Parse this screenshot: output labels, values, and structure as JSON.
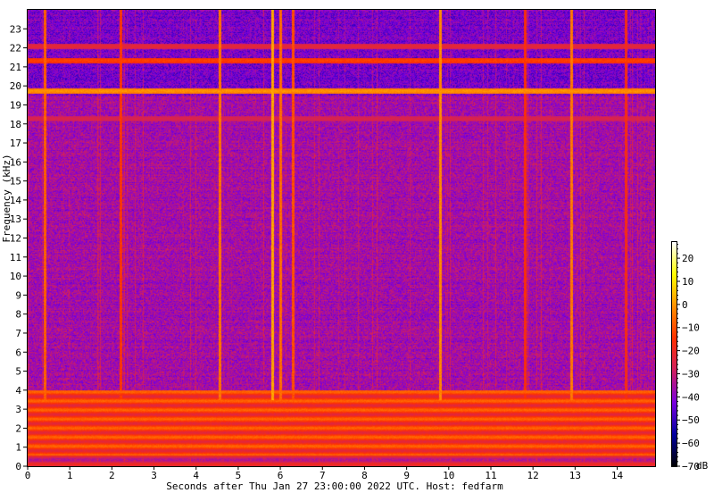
{
  "chart_data": {
    "type": "heatmap",
    "title": "",
    "xlabel": "Seconds after Thu Jan 27 23:00:00 2022 UTC. Host: fedfarm",
    "ylabel": "Frequency (kHz)",
    "xlim": [
      0,
      14.9
    ],
    "ylim": [
      0,
      24
    ],
    "xticks": [
      0,
      1,
      2,
      3,
      4,
      5,
      6,
      7,
      8,
      9,
      10,
      11,
      12,
      13,
      14
    ],
    "yticks": [
      0,
      1,
      2,
      3,
      4,
      5,
      6,
      7,
      8,
      9,
      10,
      11,
      12,
      13,
      14,
      15,
      16,
      17,
      18,
      19,
      20,
      21,
      22,
      23
    ],
    "colorbar": {
      "label": "dB",
      "range": [
        -70,
        27
      ],
      "ticks": [
        -70,
        -60,
        -50,
        -40,
        -30,
        -20,
        -10,
        0,
        10,
        20
      ],
      "colormap": [
        "#000000",
        "#0000a0",
        "#7a00e0",
        "#d02060",
        "#ff3000",
        "#ff9000",
        "#ffff00",
        "#ffffff"
      ]
    },
    "tonal_lines_khz": [
      {
        "freq": 19.75,
        "level_db": 0
      },
      {
        "freq": 21.35,
        "level_db": -12
      },
      {
        "freq": 22.1,
        "level_db": -22
      },
      {
        "freq": 18.3,
        "level_db": -25
      }
    ],
    "transients_s": [
      {
        "time": 0.4,
        "level_db": -8
      },
      {
        "time": 2.2,
        "level_db": -14
      },
      {
        "time": 4.55,
        "level_db": -5
      },
      {
        "time": 5.8,
        "level_db": 2
      },
      {
        "time": 6.0,
        "level_db": -6
      },
      {
        "time": 6.3,
        "level_db": -10
      },
      {
        "time": 9.8,
        "level_db": -2
      },
      {
        "time": 12.9,
        "level_db": -4
      },
      {
        "time": 11.8,
        "level_db": -16
      },
      {
        "time": 14.2,
        "level_db": -18
      }
    ],
    "low_band_khz": {
      "upper": 4,
      "level_db": -15
    },
    "background_db": -38
  }
}
